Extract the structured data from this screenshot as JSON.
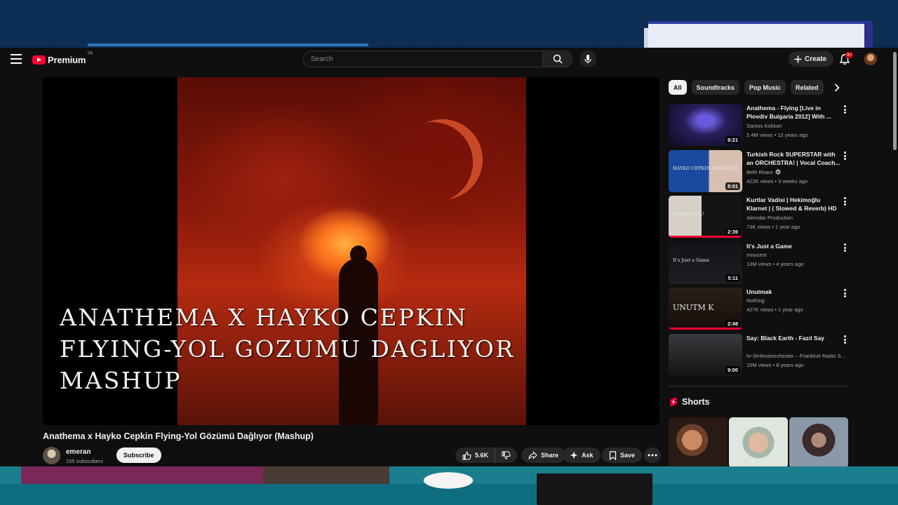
{
  "masthead": {
    "logo_text": "Premium",
    "logo_country": "TR",
    "search_placeholder": "Search",
    "create_label": "Create",
    "notification_count": "9+"
  },
  "video": {
    "overlay_lines": [
      "ANATHEMA X HAYKO CEPKIN",
      "FLYING-YOL GOZUMU DAGLIYOR",
      "MASHUP"
    ],
    "title": "Anathema x Hayko Cepkin Flying-Yol Gözümü Dağlıyor (Mashup)",
    "channel": "emeran",
    "subscribers": "155 subscribers",
    "subscribe_label": "Subscribe",
    "likes": "5.6K",
    "share_label": "Share",
    "ask_label": "Ask",
    "save_label": "Save"
  },
  "chips": [
    "All",
    "Soundtracks",
    "Pop Music",
    "Related"
  ],
  "recommendations": [
    {
      "title": "Anathema - Flying [Live in Plovdiv Bulgaria 2012] With ...",
      "channel": "Samos Kokkari",
      "meta": "2.4M views • 12 years ago",
      "duration": "9:21",
      "verified": false,
      "progress": 0
    },
    {
      "title": "Turkish Rock SUPERSTAR with an ORCHESTRA! | Vocal Coach...",
      "channel": "Beth Roars",
      "meta": "422K views • 3 weeks ago",
      "duration": "8:01",
      "verified": true,
      "progress": 0
    },
    {
      "title": "Kurtlar Vadisi | Hekimoğlu Klarnet | ( Slowed & Reverb) HD",
      "channel": "Alemdar Production",
      "meta": "73K views • 1 year ago",
      "duration": "2:39",
      "verified": false,
      "progress": 1.0
    },
    {
      "title": "It's Just a Game",
      "channel": "Innocent",
      "meta": "13M views • 4 years ago",
      "duration": "5:11",
      "verified": false,
      "progress": 0
    },
    {
      "title": "Unutmak",
      "channel": "Nothing",
      "meta": "427K views • 1 year ago",
      "duration": "2:48",
      "verified": false,
      "progress": 1.0
    },
    {
      "title": "Say: Black Earth - Fazıl Say",
      "channel": "hr-Sinfonieorchester – Frankfurt Radio S...",
      "meta": "10M views • 8 years ago",
      "duration": "9:00",
      "verified": false,
      "progress": 0
    }
  ],
  "thumb_texts": [
    "",
    "HAYKO CEPKIN PARANOYA",
    "HEKIMOĞLU",
    "It's Just a Game",
    "UNUTM K",
    ""
  ],
  "shorts_heading": "Shorts",
  "colors": {
    "accent": "#ff0033",
    "background": "#0f0f0f",
    "chip_active": "#f1f1f1"
  }
}
